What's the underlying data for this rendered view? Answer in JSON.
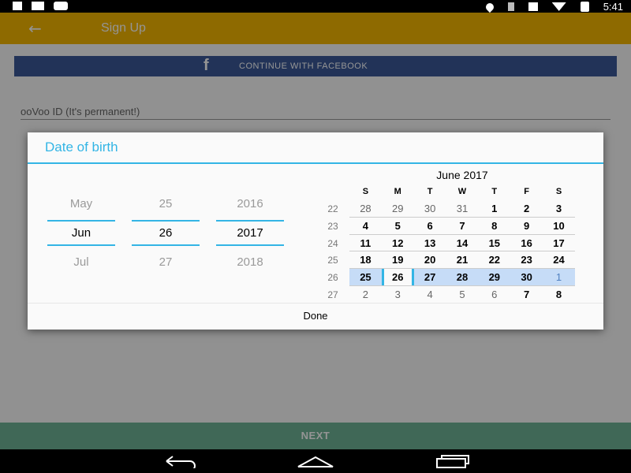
{
  "status_bar": {
    "left_icons": [
      "download-icon",
      "signal-bars-icon",
      "youtube-icon"
    ],
    "right_icons": [
      "location-icon",
      "bluetooth-icon",
      "airplane-icon",
      "wifi-icon",
      "battery-icon"
    ],
    "time": "5:41"
  },
  "app_bar": {
    "back_icon": "back-arrow-icon",
    "title": "Sign Up"
  },
  "page": {
    "facebook_button": {
      "icon": "facebook-f-icon",
      "icon_glyph": "f",
      "label": "CONTINUE WITH FACEBOOK"
    },
    "oovoo_id_hint": "ooVoo ID (It's permanent!)",
    "next_button": "NEXT"
  },
  "dialog": {
    "title": "Date of birth",
    "month_picker": {
      "prev": "May",
      "current": "Jun",
      "next": "Jul"
    },
    "day_picker": {
      "prev": "25",
      "current": "26",
      "next": "27"
    },
    "year_picker": {
      "prev": "2016",
      "current": "2017",
      "next": "2018"
    },
    "calendar": {
      "title": "June 2017",
      "day_headers": [
        "S",
        "M",
        "T",
        "W",
        "T",
        "F",
        "S"
      ],
      "weeks": [
        {
          "week": "22",
          "days": [
            "28",
            "29",
            "30",
            "31",
            "1",
            "2",
            "3"
          ]
        },
        {
          "week": "23",
          "days": [
            "4",
            "5",
            "6",
            "7",
            "8",
            "9",
            "10"
          ]
        },
        {
          "week": "24",
          "days": [
            "11",
            "12",
            "13",
            "14",
            "15",
            "16",
            "17"
          ]
        },
        {
          "week": "25",
          "days": [
            "18",
            "19",
            "20",
            "21",
            "22",
            "23",
            "24"
          ]
        },
        {
          "week": "26",
          "days": [
            "25",
            "26",
            "27",
            "28",
            "29",
            "30",
            "1"
          ]
        },
        {
          "week": "27",
          "days": [
            "2",
            "3",
            "4",
            "5",
            "6",
            "7",
            "8"
          ]
        }
      ],
      "selected_day": "26"
    },
    "done_button": "Done"
  },
  "nav_bar": {
    "back": "nav-back-icon",
    "home": "nav-home-icon",
    "recents": "nav-recents-icon"
  },
  "colors": {
    "accent": "#33b5e5",
    "app_bar": "#f5b700",
    "facebook": "#3b5998",
    "next_bar": "#6fb396",
    "current_week_highlight": "#c6dcf7"
  }
}
